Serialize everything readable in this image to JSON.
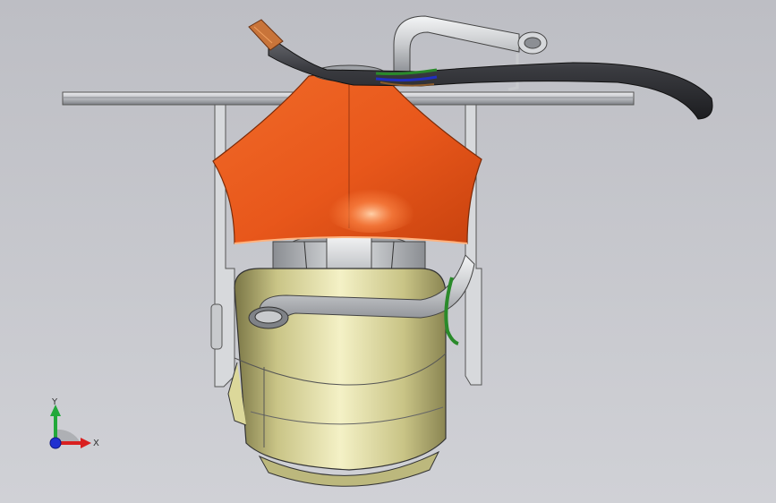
{
  "viewport": {
    "background_top": "#bdbec4",
    "background_bottom": "#d0d1d6"
  },
  "model": {
    "colors": {
      "shade": "#e8571b",
      "shade_light": "#ff8a4a",
      "housing": "#e5e2a8",
      "housing_dark": "#8f8b55",
      "pipe": "#d6d8db",
      "cable": "#3a3b40",
      "rail": "#b9bbc0",
      "ground_wire": "#2a8a2a",
      "copper": "#c8743a"
    },
    "icons": [
      "orientation-triad-icon"
    ]
  },
  "triad": {
    "x_label": "X",
    "y_label": "Y",
    "x_color": "#d92020",
    "y_color": "#22a83a",
    "z_color": "#2030d0"
  }
}
